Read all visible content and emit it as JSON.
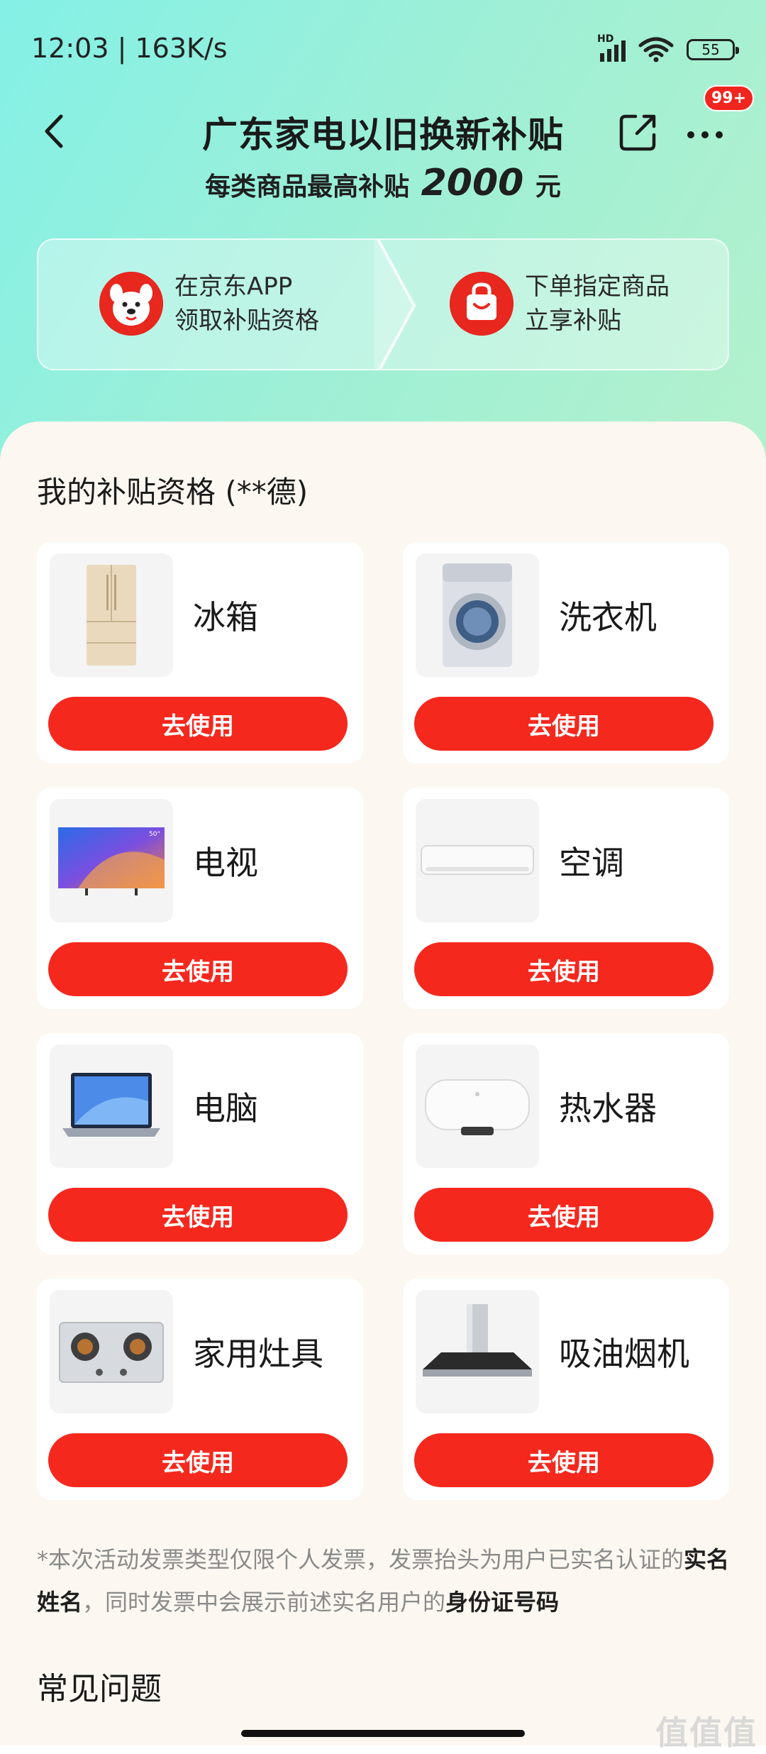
{
  "status_bar": {
    "time": "12:03 | 163K/s",
    "network_label": "HD",
    "battery": "55"
  },
  "nav": {
    "title": "广东家电以旧换新补贴",
    "badge": "99+"
  },
  "subtitle": {
    "prefix": "每类商品最高补贴",
    "amount": "2000",
    "suffix": "元"
  },
  "steps": [
    {
      "line1": "在京东APP",
      "line2": "领取补贴资格"
    },
    {
      "line1": "下单指定商品",
      "line2": "立享补贴"
    }
  ],
  "section_title": "我的补贴资格 (**德)",
  "items": [
    {
      "name": "冰箱",
      "button": "去使用",
      "icon": "refrigerator-icon"
    },
    {
      "name": "洗衣机",
      "button": "去使用",
      "icon": "washing-machine-icon"
    },
    {
      "name": "电视",
      "button": "去使用",
      "icon": "tv-icon",
      "tv_tag": "50\""
    },
    {
      "name": "空调",
      "button": "去使用",
      "icon": "air-conditioner-icon"
    },
    {
      "name": "电脑",
      "button": "去使用",
      "icon": "laptop-icon"
    },
    {
      "name": "热水器",
      "button": "去使用",
      "icon": "water-heater-icon"
    },
    {
      "name": "家用灶具",
      "button": "去使用",
      "icon": "gas-stove-icon"
    },
    {
      "name": "吸油烟机",
      "button": "去使用",
      "icon": "range-hood-icon"
    }
  ],
  "note": {
    "part1": "*本次活动发票类型仅限个人发票，发票抬头为用户已实名认证的",
    "bold1": "实名姓名",
    "part2": "，同时发票中会展示前述实名用户的",
    "bold2": "身份证号码"
  },
  "faq_title": "常见问题",
  "watermark": "值值值",
  "colors": {
    "accent_red": "#F5281E",
    "header_gradient_start": "#84F0E6",
    "header_gradient_end": "#B4F1CC",
    "panel_bg": "#FCF8F1"
  }
}
